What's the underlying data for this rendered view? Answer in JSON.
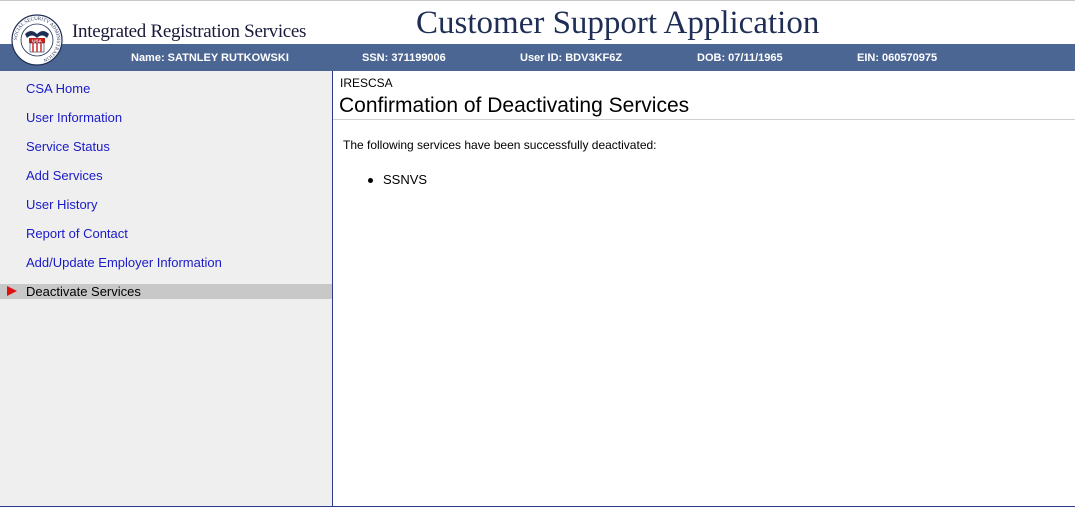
{
  "header": {
    "org_title": "Integrated Registration Services",
    "app_title": "Customer Support Application",
    "seal_text": "SOCIAL SECURITY ADMINISTRATION",
    "seal_center": "USA"
  },
  "user_bar": {
    "name": "Name: SATNLEY RUTKOWSKI",
    "ssn": "SSN: 371199006",
    "user_id": "User ID: BDV3KF6Z",
    "dob": "DOB: 07/11/1965",
    "ein": "EIN: 060570975"
  },
  "sidebar": {
    "items": [
      {
        "label": "CSA Home"
      },
      {
        "label": "User Information"
      },
      {
        "label": "Service Status"
      },
      {
        "label": "Add Services"
      },
      {
        "label": "User History"
      },
      {
        "label": "Report of Contact"
      },
      {
        "label": "Add/Update Employer Information"
      }
    ],
    "active": {
      "label": "Deactivate Services"
    }
  },
  "main": {
    "breadcrumb": "IRESCSA",
    "title": "Confirmation of Deactivating Services",
    "message": "The following services have been successfully deactivated:",
    "services": [
      "SSNVS"
    ]
  },
  "colors": {
    "user_bar_bg": "#4c6694",
    "sidebar_bg": "#efefef",
    "active_item_bg": "#c8c8c8",
    "link": "#1a1ac8",
    "active_arrow": "#e01010",
    "app_title": "#1f2e55"
  }
}
